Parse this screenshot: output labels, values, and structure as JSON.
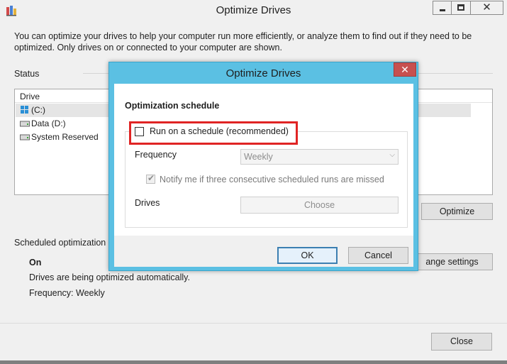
{
  "window": {
    "title": "Optimize Drives",
    "intro": "You can optimize your drives to help your computer run more efficiently, or analyze them to find out if they need to be optimized. Only drives on or connected to your computer are shown.",
    "status_label": "Status",
    "drive_column": "Drive",
    "drives": [
      "(C:)",
      "Data (D:)",
      "System Reserved"
    ],
    "optimize_button": "Optimize",
    "scheduled_label": "Scheduled optimization",
    "schedule_state": "On",
    "schedule_desc": "Drives are being optimized automatically.",
    "schedule_freq": "Frequency: Weekly",
    "change_settings_button": "ange settings",
    "close_button": "Close"
  },
  "dialog": {
    "title": "Optimize Drives",
    "heading": "Optimization schedule",
    "run_on_schedule_label": "Run on a schedule (recommended)",
    "run_on_schedule_checked": false,
    "frequency_label": "Frequency",
    "frequency_value": "Weekly",
    "notify_label": "Notify me if three consecutive scheduled runs are missed",
    "notify_checked": true,
    "drives_label": "Drives",
    "choose_button": "Choose",
    "ok_button": "OK",
    "cancel_button": "Cancel"
  },
  "colors": {
    "dialog_frame": "#5bc0e3",
    "close_red": "#c75050",
    "highlight_red": "#e02424",
    "ok_border": "#3c7fb1"
  }
}
